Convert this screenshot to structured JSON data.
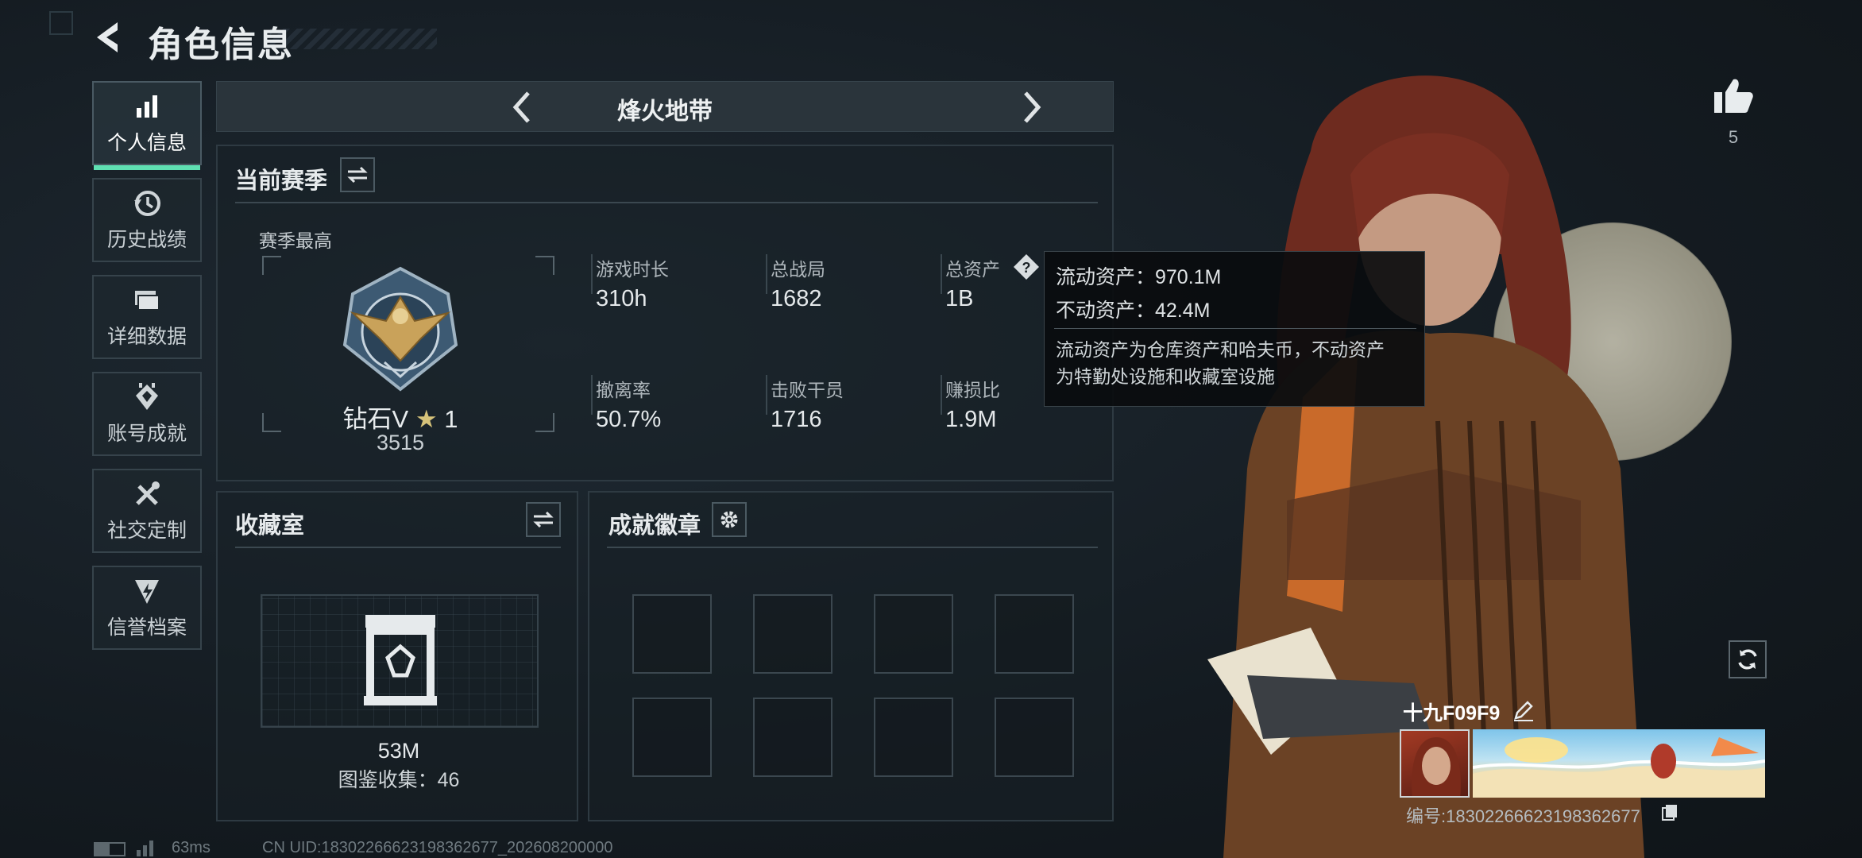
{
  "header": {
    "title": "角色信息"
  },
  "sidebar": {
    "items": [
      {
        "label": "个人信息",
        "icon": "bar-chart-icon"
      },
      {
        "label": "历史战绩",
        "icon": "history-icon"
      },
      {
        "label": "详细数据",
        "icon": "folder-icon"
      },
      {
        "label": "账号成就",
        "icon": "achievement-icon"
      },
      {
        "label": "社交定制",
        "icon": "tools-icon"
      },
      {
        "label": "信誉档案",
        "icon": "shield-icon"
      }
    ]
  },
  "mode": {
    "title": "烽火地带"
  },
  "season": {
    "title": "当前赛季",
    "best_label": "赛季最高",
    "rank": "钻石V",
    "stars": "1",
    "score": "3515",
    "stats": [
      {
        "label": "游戏时长",
        "value": "310h"
      },
      {
        "label": "总战局",
        "value": "1682"
      },
      {
        "label": "总资产",
        "value": "1B"
      },
      {
        "label": "撤离率",
        "value": "50.7%"
      },
      {
        "label": "击败干员",
        "value": "1716"
      },
      {
        "label": "赚损比",
        "value": "1.9M"
      }
    ]
  },
  "tooltip": {
    "liquid": "流动资产：970.1M",
    "fixed": "不动资产：42.4M",
    "desc_line1": "流动资产为仓库资产和哈夫币，不动资产",
    "desc_line2": "为特勤处设施和收藏室设施"
  },
  "collection": {
    "title": "收藏室",
    "value": "53M",
    "catalog": "图鉴收集：46"
  },
  "badges": {
    "title": "成就徽章"
  },
  "likes": {
    "count": "5"
  },
  "player": {
    "name": "十九F09F9",
    "id": "编号:1830226662319836267​7"
  },
  "footer": {
    "ping": "63ms",
    "uid": "CN UID:18302266623198362677_202608200000"
  },
  "colors": {
    "accent": "#5fe0b2",
    "panel_border": "#2e3a42"
  }
}
